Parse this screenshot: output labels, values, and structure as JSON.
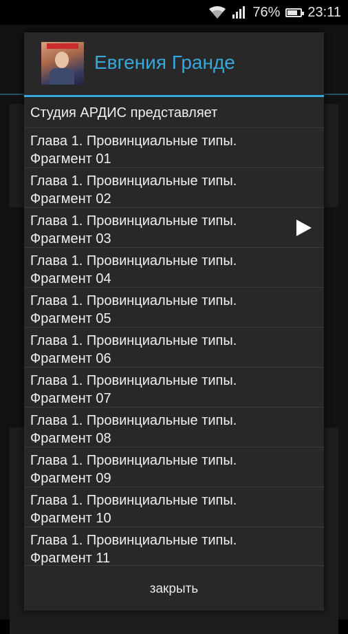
{
  "status": {
    "battery_percent": "76%",
    "time": "23:11",
    "battery_level": 0.76
  },
  "dialog": {
    "title": "Евгения Гранде",
    "items": [
      {
        "line1": "Студия АРДИС представляет",
        "line2": ""
      },
      {
        "line1": "Глава 1. Провинциальные типы.",
        "line2": "Фрагмент 01"
      },
      {
        "line1": "Глава 1. Провинциальные типы.",
        "line2": "Фрагмент 02"
      },
      {
        "line1": "Глава 1. Провинциальные типы.",
        "line2": "Фрагмент 03",
        "playing": true
      },
      {
        "line1": "Глава 1. Провинциальные типы.",
        "line2": "Фрагмент 04"
      },
      {
        "line1": "Глава 1. Провинциальные типы.",
        "line2": "Фрагмент 05"
      },
      {
        "line1": "Глава 1. Провинциальные типы.",
        "line2": "Фрагмент 06"
      },
      {
        "line1": "Глава 1. Провинциальные типы.",
        "line2": "Фрагмент 07"
      },
      {
        "line1": "Глава 1. Провинциальные типы.",
        "line2": "Фрагмент 08"
      },
      {
        "line1": "Глава 1. Провинциальные типы.",
        "line2": "Фрагмент 09"
      },
      {
        "line1": "Глава 1. Провинциальные типы.",
        "line2": "Фрагмент 10"
      },
      {
        "line1": "Глава 1. Провинциальные типы.",
        "line2": "Фрагмент 11"
      }
    ],
    "close_label": "закрыть"
  },
  "colors": {
    "accent": "#35a8dc",
    "dialog_bg": "#282828",
    "divider": "#3a3a3a"
  },
  "icons": {
    "playing": "play-icon",
    "wifi": "wifi-icon",
    "signal": "signal-icon",
    "battery": "battery-icon"
  }
}
